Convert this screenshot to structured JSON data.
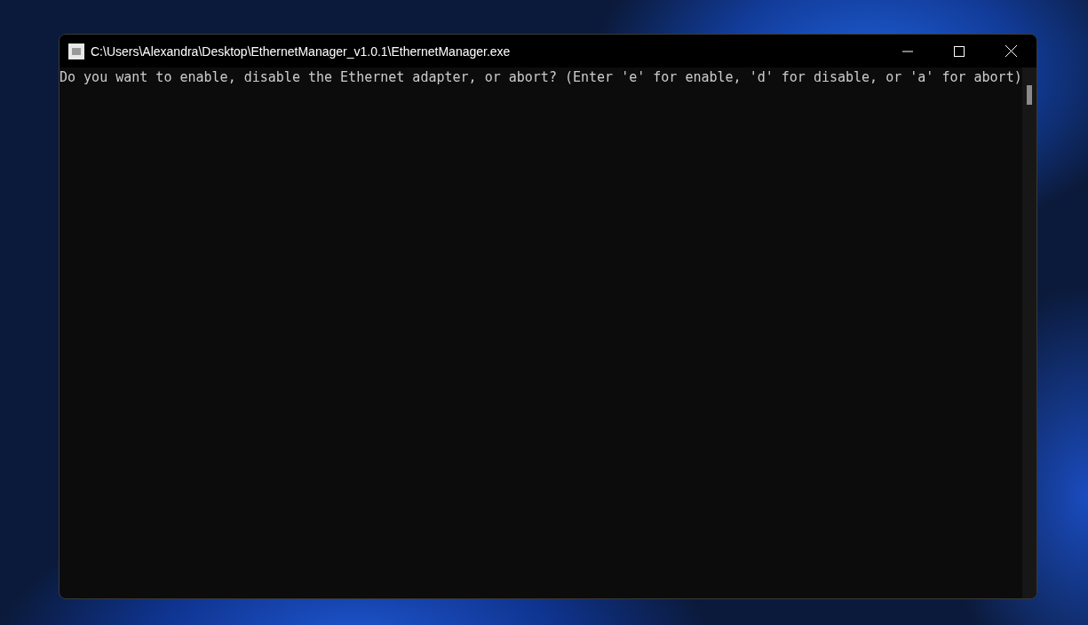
{
  "window": {
    "title": "C:\\Users\\Alexandra\\Desktop\\EthernetManager_v1.0.1\\EthernetManager.exe"
  },
  "console": {
    "lines": [
      "Do you want to enable, disable the Ethernet adapter, or abort? (Enter 'e' for enable, 'd' for disable, or 'a' for abort)"
    ]
  }
}
